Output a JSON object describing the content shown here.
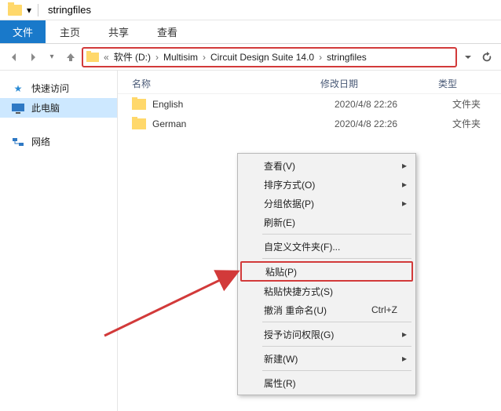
{
  "titlebar": {
    "title": "stringfiles"
  },
  "ribbon": {
    "file": "文件",
    "tabs": [
      "主页",
      "共享",
      "查看"
    ]
  },
  "address": {
    "laquo": "«",
    "segs": [
      "软件 (D:)",
      "Multisim",
      "Circuit Design Suite 14.0",
      "stringfiles"
    ]
  },
  "sidebar": {
    "quick": "快速访问",
    "pc": "此电脑",
    "network": "网络"
  },
  "columns": {
    "name": "名称",
    "date": "修改日期",
    "type": "类型"
  },
  "rows": [
    {
      "name": "English",
      "date": "2020/4/8 22:26",
      "type": "文件夹"
    },
    {
      "name": "German",
      "date": "2020/4/8 22:26",
      "type": "文件夹"
    }
  ],
  "ctx": {
    "view": "查看(V)",
    "sort": "排序方式(O)",
    "group": "分组依据(P)",
    "refresh": "刷新(E)",
    "customize": "自定义文件夹(F)...",
    "paste": "粘贴(P)",
    "pasteShortcut": "粘贴快捷方式(S)",
    "undo": "撤消 重命名(U)",
    "undoKey": "Ctrl+Z",
    "grant": "授予访问权限(G)",
    "new": "新建(W)",
    "props": "属性(R)"
  }
}
